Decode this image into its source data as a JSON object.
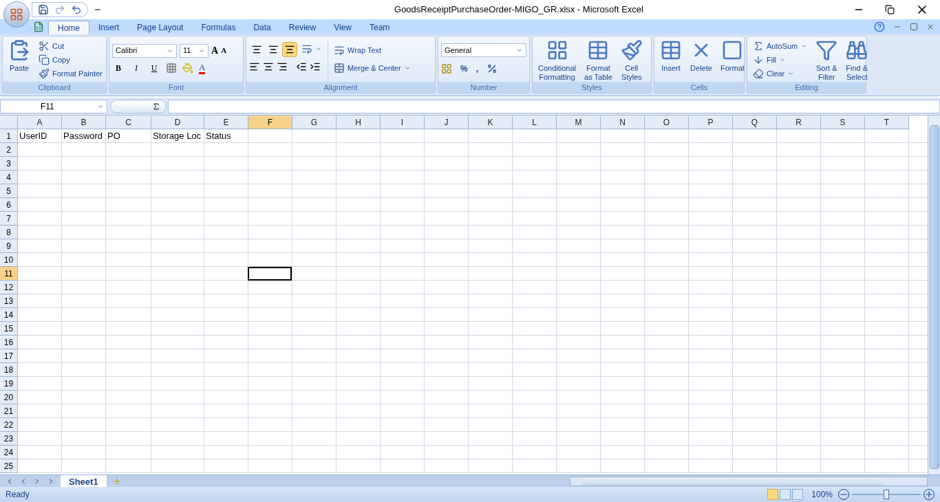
{
  "window": {
    "title": "GoodsReceiptPurchaseOrder-MIGO_GR.xlsx - Microsoft Excel"
  },
  "tabs": [
    {
      "label": "Home",
      "selected": true
    },
    {
      "label": "Insert",
      "selected": false
    },
    {
      "label": "Page Layout",
      "selected": false
    },
    {
      "label": "Formulas",
      "selected": false
    },
    {
      "label": "Data",
      "selected": false
    },
    {
      "label": "Review",
      "selected": false
    },
    {
      "label": "View",
      "selected": false
    },
    {
      "label": "Team",
      "selected": false
    }
  ],
  "ribbon": {
    "clipboard": {
      "label": "Clipboard",
      "paste": "Paste",
      "items": [
        "Cut",
        "Copy",
        "Format Painter"
      ]
    },
    "font": {
      "label": "Font",
      "font_name": "Calibri",
      "font_size": "11",
      "grow": "A",
      "shrink": "A",
      "styles": [
        "B",
        "I",
        "U"
      ],
      "font_color": "A"
    },
    "alignment": {
      "label": "Alignment",
      "vertical": [
        {
          "selected": false
        },
        {
          "selected": false
        },
        {
          "selected": true
        }
      ],
      "wrap": "Wrap Text",
      "merge": "Merge & Center"
    },
    "number": {
      "label": "Number",
      "format": "General",
      "percent": "%",
      "comma": ","
    },
    "styles": {
      "label": "Styles",
      "buttons": [
        {
          "line1": "Conditional",
          "line2": "Formatting"
        },
        {
          "line1": "Format",
          "line2": "as Table"
        },
        {
          "line1": "Cell",
          "line2": "Styles"
        }
      ]
    },
    "cells": {
      "label": "Cells",
      "buttons": [
        "Insert",
        "Delete",
        "Format"
      ]
    },
    "editing": {
      "label": "Editing",
      "small": [
        "AutoSum",
        "Fill",
        "Clear"
      ],
      "big": [
        {
          "line1": "Sort &",
          "line2": "Filter"
        },
        {
          "line1": "Find &",
          "line2": "Select"
        }
      ]
    }
  },
  "formula_bar": {
    "name_box": "F11"
  },
  "sheet": {
    "columns": [
      {
        "label": "A",
        "selected": false
      },
      {
        "label": "B",
        "selected": false
      },
      {
        "label": "C",
        "selected": false
      },
      {
        "label": "D",
        "selected": false
      },
      {
        "label": "E",
        "selected": false
      },
      {
        "label": "F",
        "selected": true
      },
      {
        "label": "G",
        "selected": false
      },
      {
        "label": "H",
        "selected": false
      },
      {
        "label": "I",
        "selected": false
      },
      {
        "label": "J",
        "selected": false
      },
      {
        "label": "K",
        "selected": false
      },
      {
        "label": "L",
        "selected": false
      },
      {
        "label": "M",
        "selected": false
      },
      {
        "label": "N",
        "selected": false
      },
      {
        "label": "O",
        "selected": false
      },
      {
        "label": "P",
        "selected": false
      },
      {
        "label": "Q",
        "selected": false
      },
      {
        "label": "R",
        "selected": false
      },
      {
        "label": "S",
        "selected": false
      },
      {
        "label": "T",
        "selected": false
      }
    ],
    "rows": [
      {
        "label": "1",
        "selected": false,
        "cells": [
          "UserID",
          "Password",
          "PO",
          "Storage Loc",
          "Status"
        ]
      },
      {
        "label": "2",
        "selected": false
      },
      {
        "label": "3",
        "selected": false
      },
      {
        "label": "4",
        "selected": false
      },
      {
        "label": "5",
        "selected": false
      },
      {
        "label": "6",
        "selected": false
      },
      {
        "label": "7",
        "selected": false
      },
      {
        "label": "8",
        "selected": false
      },
      {
        "label": "9",
        "selected": false
      },
      {
        "label": "10",
        "selected": false
      },
      {
        "label": "11",
        "selected": true
      },
      {
        "label": "12",
        "selected": false
      },
      {
        "label": "13",
        "selected": false
      },
      {
        "label": "14",
        "selected": false
      },
      {
        "label": "15",
        "selected": false
      },
      {
        "label": "16",
        "selected": false
      },
      {
        "label": "17",
        "selected": false
      },
      {
        "label": "18",
        "selected": false
      },
      {
        "label": "19",
        "selected": false
      },
      {
        "label": "20",
        "selected": false
      },
      {
        "label": "21",
        "selected": false
      },
      {
        "label": "22",
        "selected": false
      },
      {
        "label": "23",
        "selected": false
      },
      {
        "label": "24",
        "selected": false
      },
      {
        "label": "25",
        "selected": false
      }
    ]
  },
  "sheet_tabs": [
    {
      "label": "Sheet1",
      "selected": true
    }
  ],
  "status_bar": {
    "status": "Ready",
    "views": [
      {
        "selected": true
      },
      {
        "selected": false
      },
      {
        "selected": false
      }
    ],
    "zoom": "100%",
    "zoom_slider": {
      "level": 0.5
    }
  }
}
